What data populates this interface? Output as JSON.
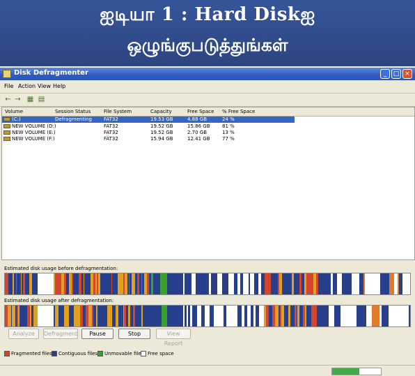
{
  "header": {
    "line1": "ஐடியா 1 : Hard Diskஐ",
    "line2": "ஒழுங்குபடுத்துங்கள்"
  },
  "window": {
    "title": "Disk Defragmenter",
    "controls": {
      "minimize": "_",
      "maximize": "□",
      "close": "×"
    }
  },
  "menu": [
    "File",
    "Action",
    "View",
    "Help"
  ],
  "toolbar": {
    "back": "←",
    "forward": "→",
    "view": "▦",
    "properties": "▤"
  },
  "volumes": {
    "columns": [
      "Volume",
      "Session Status",
      "File System",
      "Capacity",
      "Free Space",
      "% Free Space"
    ],
    "rows": [
      {
        "volume": "(C:)",
        "status": "Defragmenting",
        "fs": "FAT32",
        "capacity": "19.53 GB",
        "free": "4.88 GB",
        "pct": "24 %"
      },
      {
        "volume": "NEW VOLUME (D:)",
        "status": "",
        "fs": "FAT32",
        "capacity": "19.52 GB",
        "free": "15.86 GB",
        "pct": "81 %"
      },
      {
        "volume": "NEW VOLUME (E:)",
        "status": "",
        "fs": "FAT32",
        "capacity": "19.52 GB",
        "free": "2.70 GB",
        "pct": "13 %"
      },
      {
        "volume": "NEW VOLUME (F:)",
        "status": "",
        "fs": "FAT32",
        "capacity": "15.94 GB",
        "free": "12.41 GB",
        "pct": "77 %"
      }
    ]
  },
  "labels": {
    "before": "Estimated disk usage before defragmentation:",
    "after": "Estimated disk usage after defragmentation:"
  },
  "buttons": {
    "analyze": "Analyze",
    "defragment": "Defragment",
    "pause": "Pause",
    "stop": "Stop",
    "report": "View Report"
  },
  "legend": {
    "fragmented": "Fragmented files",
    "contiguous": "Contiguous files",
    "unmovable": "Unmovable files",
    "free": "Free space"
  },
  "colors": {
    "fragmented": "#d2452f",
    "contiguous": "#283f8c",
    "unmovable": "#3aa22c",
    "free": "#ffffff",
    "accent": "#3466c6"
  },
  "progress": 0.55
}
